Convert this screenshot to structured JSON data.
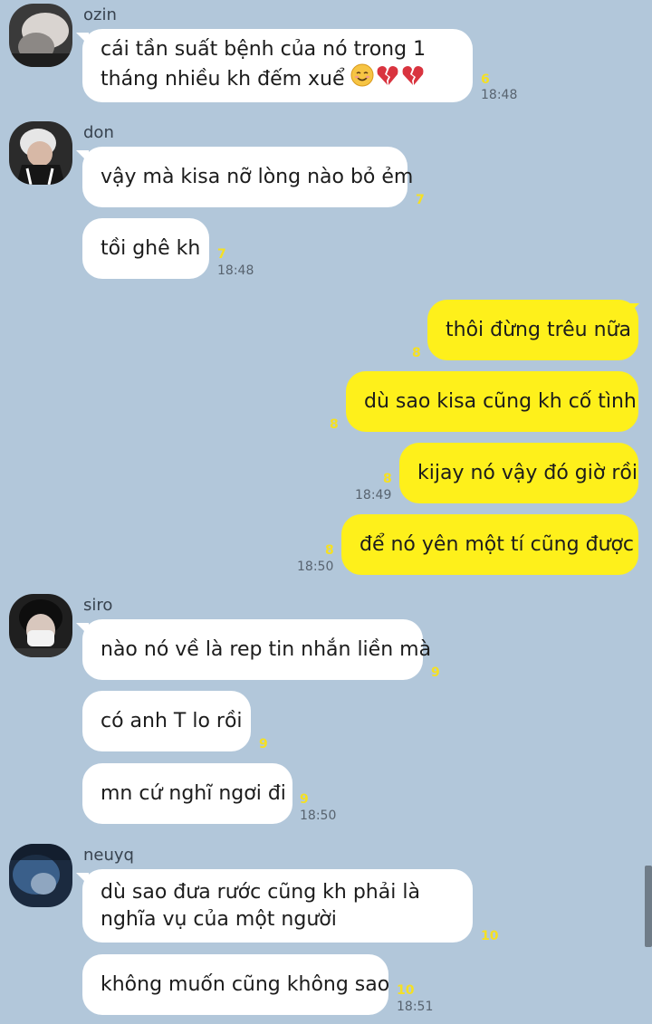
{
  "colors": {
    "background": "#b2c7da",
    "incoming_bubble": "#ffffff",
    "outgoing_bubble": "#fef01b",
    "unread_count": "#f5e023"
  },
  "groups": [
    {
      "sender": "ozin",
      "avatar": "avatar-ozin",
      "messages": [
        {
          "lines": [
            "cái tần suất bệnh của nó trong 1",
            "tháng nhiều kh đếm xuể"
          ],
          "emoji": [
            "smiling-face-icon",
            "broken-heart-icon",
            "broken-heart-icon"
          ],
          "unread": "6",
          "time": "18:48"
        }
      ]
    },
    {
      "sender": "don",
      "avatar": "avatar-don",
      "messages": [
        {
          "text": "vậy mà kisa nỡ lòng nào bỏ ẻm",
          "unread": "7"
        },
        {
          "text": "tồi ghê kh",
          "unread": "7",
          "time": "18:48"
        }
      ]
    },
    {
      "sender": "",
      "outgoing": true,
      "messages": [
        {
          "text": "thôi đừng trêu nữa",
          "unread": "8"
        },
        {
          "text": "dù sao kisa cũng kh cố tình",
          "unread": "8"
        },
        {
          "text": "kijay nó vậy đó giờ rồi",
          "unread": "8",
          "time": "18:49"
        },
        {
          "text": "để nó yên một tí cũng được",
          "unread": "8",
          "time": "18:50"
        }
      ]
    },
    {
      "sender": "siro",
      "avatar": "avatar-siro",
      "messages": [
        {
          "text": "nào nó về là rep tin nhắn liền mà",
          "unread": "9"
        },
        {
          "text": "có anh T lo rồi",
          "unread": "9"
        },
        {
          "text": "mn cứ nghĩ ngơi đi",
          "unread": "9",
          "time": "18:50"
        }
      ]
    },
    {
      "sender": "neuyq",
      "avatar": "avatar-neuyq",
      "messages": [
        {
          "lines": [
            "dù sao đưa rước cũng kh phải là",
            "nghĩa vụ của một người"
          ],
          "unread": "10"
        },
        {
          "text": "không muốn cũng không sao",
          "unread": "10",
          "time": "18:51"
        }
      ]
    }
  ]
}
